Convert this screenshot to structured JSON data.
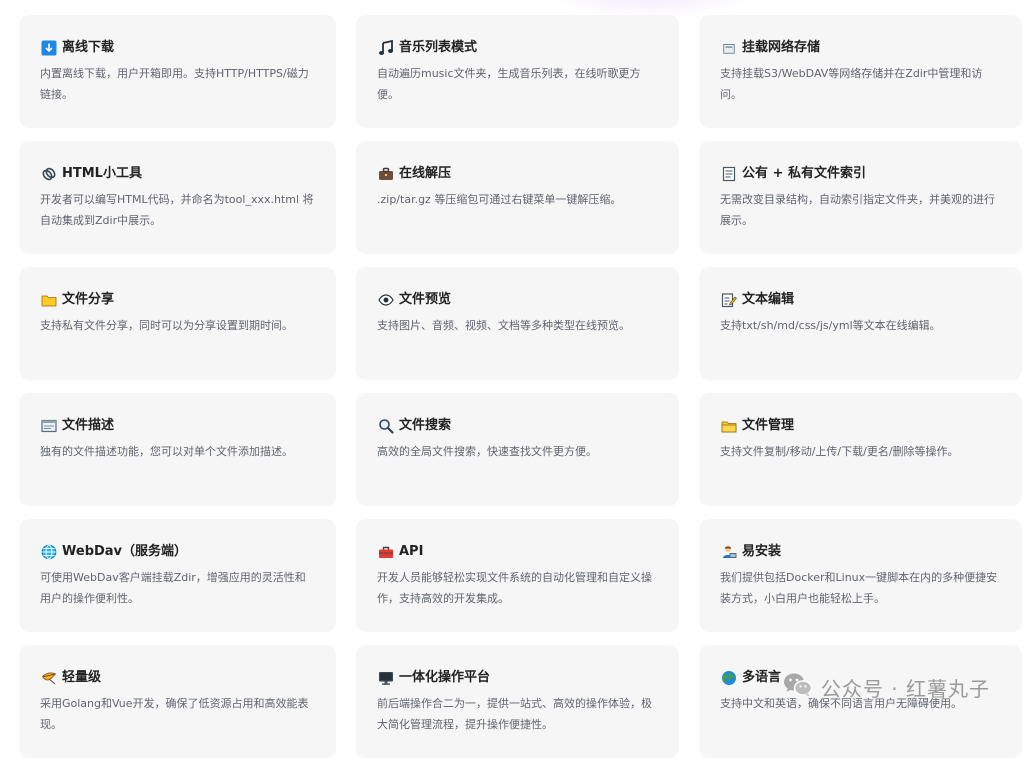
{
  "features": [
    {
      "title": "离线下载",
      "icon": "download-icon",
      "desc": "内置离线下载，用户开箱即用。支持HTTP/HTTPS/磁力链接。"
    },
    {
      "title": "音乐列表模式",
      "icon": "music-note-icon",
      "desc": "自动遍历music文件夹，生成音乐列表，在线听歌更方便。"
    },
    {
      "title": "挂载网络存储",
      "icon": "storage-icon",
      "desc": "支持挂载S3/WebDAV等网络存储并在Zdir中管理和访问。"
    },
    {
      "title": "HTML小工具",
      "icon": "paperclip-icon",
      "desc": "开发者可以编写HTML代码，并命名为tool_xxx.html 将自动集成到Zdir中展示。"
    },
    {
      "title": "在线解压",
      "icon": "briefcase-icon",
      "desc": ".zip/tar.gz 等压缩包可通过右键菜单一键解压缩。"
    },
    {
      "title": "公有 + 私有文件索引",
      "icon": "document-icon",
      "desc": "无需改变目录结构，自动索引指定文件夹，并美观的进行展示。"
    },
    {
      "title": "文件分享",
      "icon": "folder-icon",
      "desc": "支持私有文件分享，同时可以为分享设置到期时间。"
    },
    {
      "title": "文件预览",
      "icon": "eye-icon",
      "desc": "支持图片、音频、视频、文档等多种类型在线预览。"
    },
    {
      "title": "文本编辑",
      "icon": "edit-document-icon",
      "desc": "支持txt/sh/md/css/js/yml等文本在线编辑。"
    },
    {
      "title": "文件描述",
      "icon": "card-index-icon",
      "desc": "独有的文件描述功能，您可以对单个文件添加描述。"
    },
    {
      "title": "文件搜索",
      "icon": "magnifier-icon",
      "desc": "高效的全局文件搜索，快速查找文件更方便。"
    },
    {
      "title": "文件管理",
      "icon": "folder-open-icon",
      "desc": "支持文件复制/移动/上传/下载/更名/删除等操作。"
    },
    {
      "title": "WebDav（服务端）",
      "icon": "globe-icon",
      "desc": "可使用WebDav客户端挂载Zdir，增强应用的灵活性和用户的操作便利性。"
    },
    {
      "title": "API",
      "icon": "toolbox-icon",
      "desc": "开发人员能够轻松实现文件系统的自动化管理和自定义操作，支持高效的开发集成。"
    },
    {
      "title": "易安装",
      "icon": "technologist-icon",
      "desc": "我们提供包括Docker和Linux一键脚本在内的多种便捷安装方式，小白用户也能轻松上手。"
    },
    {
      "title": "轻量级",
      "icon": "feather-icon",
      "desc": "采用Golang和Vue开发，确保了低资源占用和高效能表现。"
    },
    {
      "title": "一体化操作平台",
      "icon": "monitor-icon",
      "desc": "前后端操作合二为一，提供一站式、高效的操作体验，极大简化管理流程，提升操作便捷性。"
    },
    {
      "title": "多语言",
      "icon": "earth-icon",
      "desc": "支持中文和英语，确保不同语言用户无障碍使用。"
    }
  ],
  "watermark": {
    "text": "公众号 · 红薯丸子",
    "icon": "wechat-icon"
  }
}
